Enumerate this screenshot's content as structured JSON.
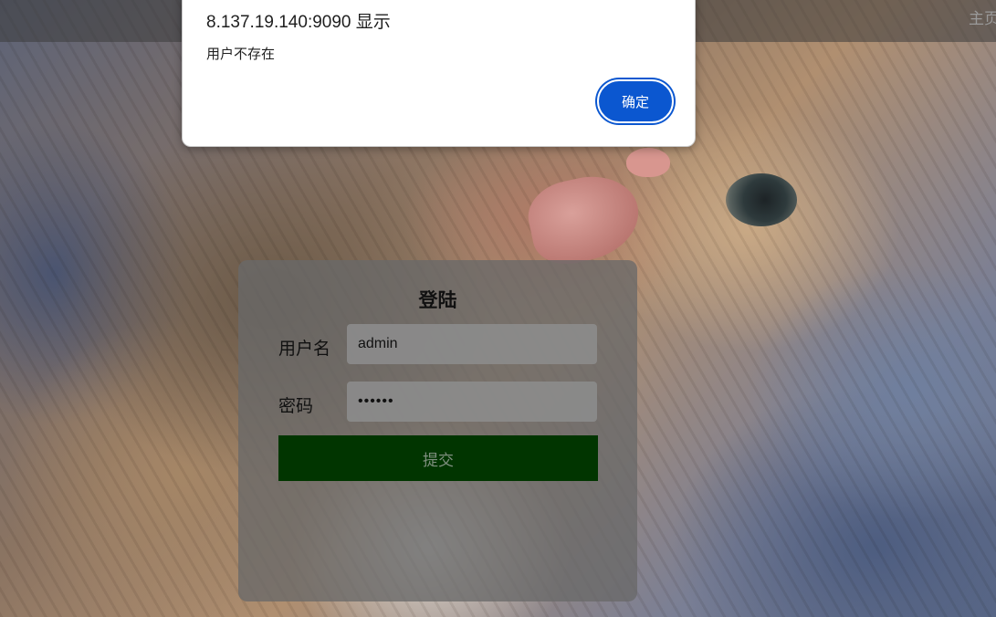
{
  "header": {
    "nav_home": "主页"
  },
  "alert": {
    "title": "8.137.19.140:9090 显示",
    "message": "用户不存在",
    "ok_label": "确定",
    "accent_color": "#0b57d0"
  },
  "login": {
    "title": "登陆",
    "username_label": "用户名",
    "username_value": "admin",
    "password_label": "密码",
    "password_value": "••••••",
    "submit_label": "提交",
    "submit_color": "#013500"
  }
}
